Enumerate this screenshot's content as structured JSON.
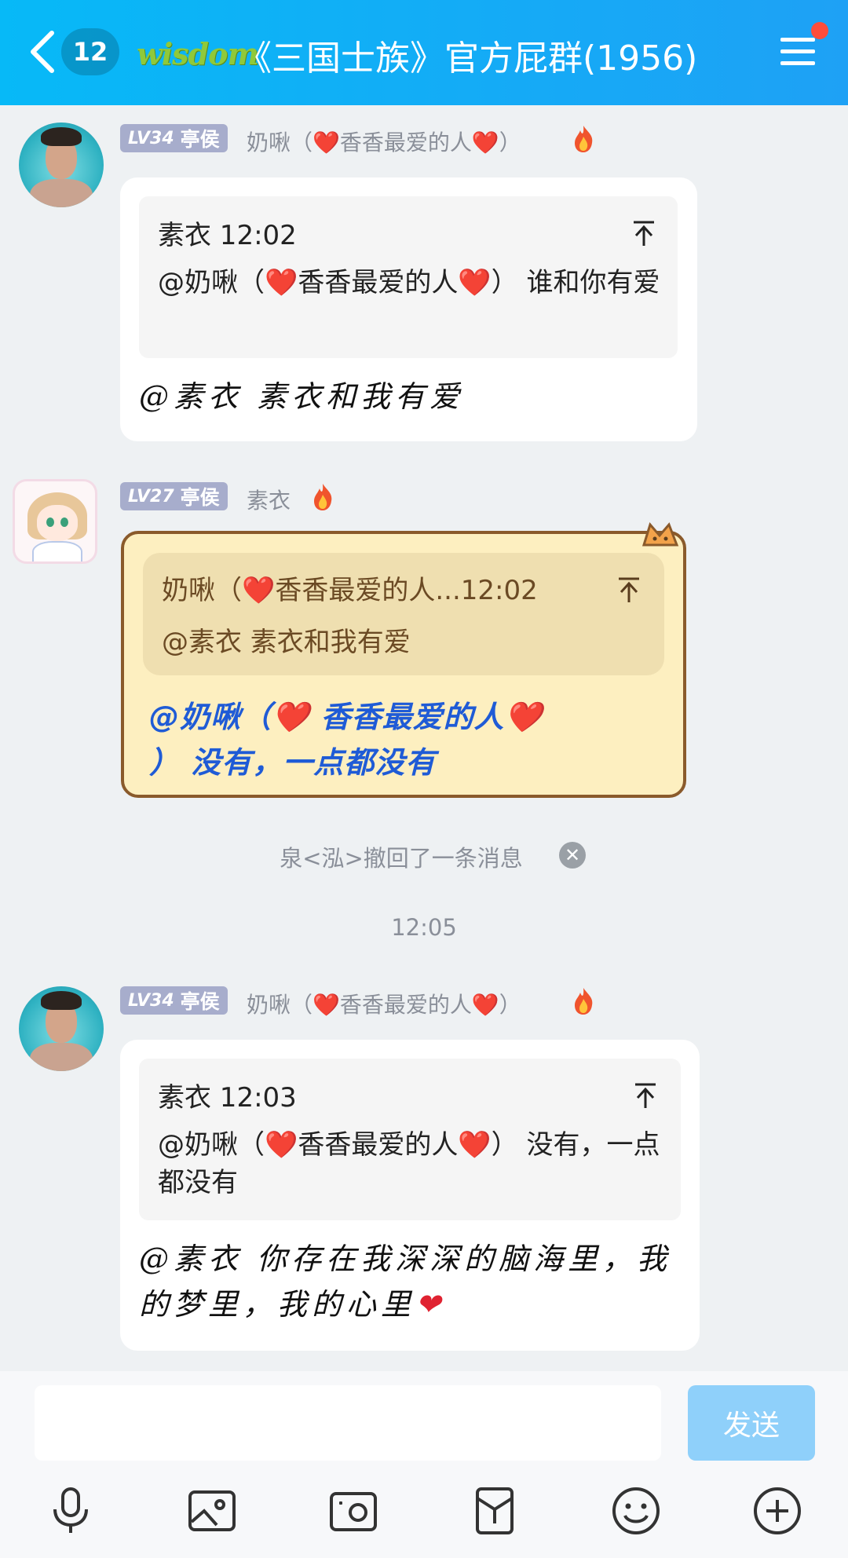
{
  "header": {
    "unread_count": "12",
    "group_logo": "wisdom",
    "title": "《三国士族》官方屁群(1956)",
    "back_icon": "chevron-left-icon",
    "menu_icon": "hamburger-menu-icon",
    "accent_color": "#1ea1f5"
  },
  "messages": [
    {
      "avatar": "pool-photo-avatar",
      "level": "LV34",
      "title": "亭侯",
      "sender": "奶啾（❤️香香最爱的人❤️）",
      "badge_icon": "flame-icon",
      "quote": {
        "author_time": "素衣 12:02",
        "text": "@奶啾（❤️香香最爱的人❤️） 谁和你有爱"
      },
      "text": "@素衣 素衣和我有爱"
    },
    {
      "avatar": "anime-girl-avatar",
      "level": "LV27",
      "title": "亭侯",
      "sender": "素衣",
      "badge_icon": "flame-icon",
      "quote": {
        "author_time": "奶啾（❤️香香最爱的人...12:02",
        "text": "@素衣 素衣和我有爱"
      },
      "text_line1": "@奶啾（❤️   香香最爱的人❤️",
      "text_line2": "）  没有，一点都没有"
    },
    {
      "avatar": "pool-photo-avatar",
      "level": "LV34",
      "title": "亭侯",
      "sender": "奶啾（❤️香香最爱的人❤️）",
      "badge_icon": "flame-icon",
      "quote": {
        "author_time": "素衣 12:03",
        "text": "@奶啾（❤️香香最爱的人❤️） 没有，一点都没有"
      },
      "text": "@素衣 你存在我深深的脑海里，我的梦里，我的心里"
    }
  ],
  "system": {
    "recall_notice": "泉<泓>撤回了一条消息",
    "timestamp": "12:05"
  },
  "input": {
    "value": "",
    "send_label": "发送"
  },
  "toolbar": [
    "microphone-icon",
    "image-icon",
    "camera-icon",
    "red-packet-icon",
    "emoji-icon",
    "plus-icon"
  ]
}
